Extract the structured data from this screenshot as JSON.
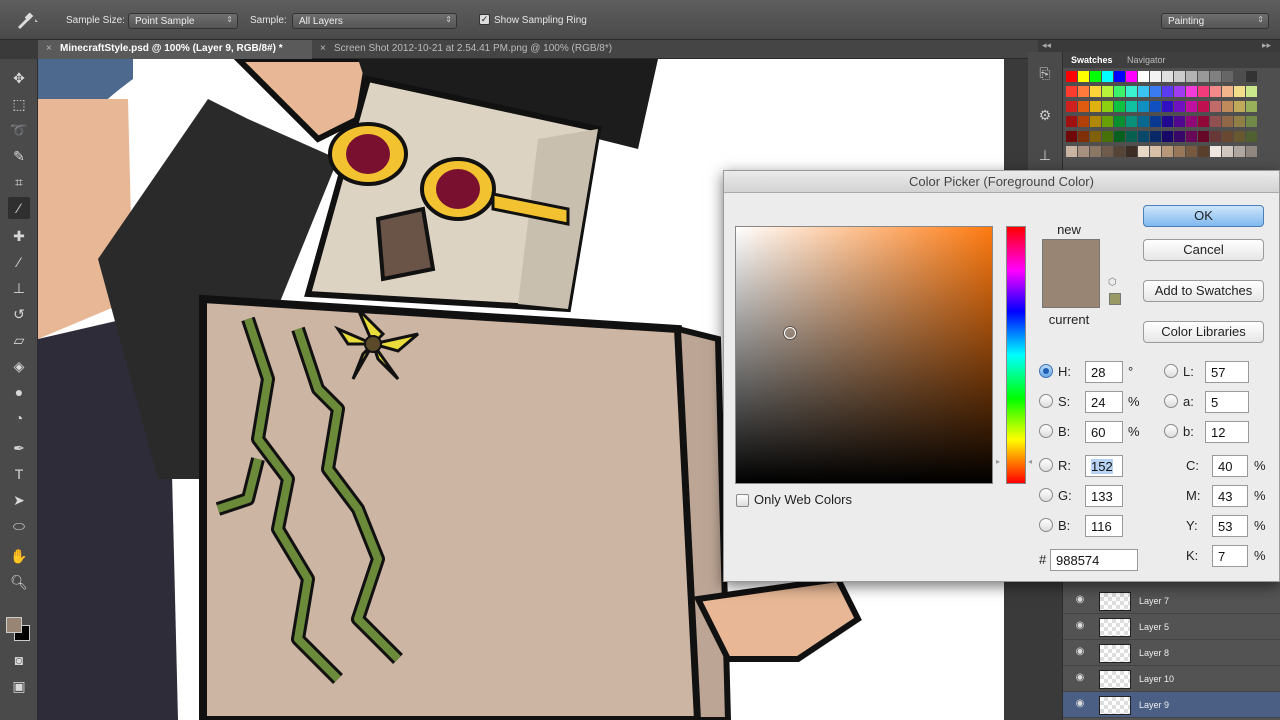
{
  "options_bar": {
    "tool_icon": "eyedropper-icon",
    "sample_size_label": "Sample Size:",
    "sample_size_value": "Point Sample",
    "sample_label": "Sample:",
    "sample_value": "All Layers",
    "show_sampling_ring_label": "Show Sampling Ring",
    "show_sampling_ring_checked": true,
    "workspace_value": "Painting"
  },
  "doc_tabs": [
    {
      "label": "MinecraftStyle.psd @ 100% (Layer 9, RGB/8#) *",
      "active": true
    },
    {
      "label": "Screen Shot 2012-10-21 at 2.54.41 PM.png @ 100% (RGB/8*)",
      "active": false
    }
  ],
  "tools": [
    "move-icon",
    "marquee-icon",
    "lasso-icon",
    "quick-select-icon",
    "crop-icon",
    "eyedropper-icon",
    "healing-icon",
    "brush-icon",
    "clone-stamp-icon",
    "history-brush-icon",
    "eraser-icon",
    "paint-bucket-icon",
    "blur-icon",
    "dodge-icon",
    "pen-icon",
    "type-icon",
    "path-select-icon",
    "shape-icon",
    "hand-icon",
    "zoom-icon"
  ],
  "colors": {
    "foreground": "#988574",
    "background": "#000000",
    "skin": "#e8b896",
    "box": "#cdb5a4",
    "vine": "#6b8a3a",
    "glasses": "#f2c230",
    "head": "#ddd3c2"
  },
  "swatches_panel": {
    "tabs": [
      "Swatches",
      "Navigator"
    ],
    "active_tab": "Swatches",
    "swatch_colors": [
      [
        "#ff0000",
        "#ffff00",
        "#00ff00",
        "#00ffff",
        "#0000ff",
        "#ff00ff",
        "#ffffff",
        "#f2f2f2",
        "#e0e0e0",
        "#cccccc",
        "#b3b3b3",
        "#999999",
        "#808080",
        "#666666",
        "#4d4d4d",
        "#333333"
      ],
      [
        "#ff3b30",
        "#ff7a3b",
        "#ffd43b",
        "#b7f23b",
        "#3bf26a",
        "#3bf2d0",
        "#3bc4f2",
        "#3b7bf2",
        "#5a3bf2",
        "#a03bf2",
        "#f23bd9",
        "#f23b7a",
        "#f28a8a",
        "#f2b48a",
        "#f2dd8a",
        "#cbe88a"
      ],
      [
        "#d02020",
        "#e05a10",
        "#e0b010",
        "#8ccf10",
        "#10c040",
        "#10c0a0",
        "#1090c0",
        "#1050c0",
        "#3010c0",
        "#7010c0",
        "#c010a0",
        "#c01050",
        "#c06a6a",
        "#c08a5a",
        "#c0aa5a",
        "#98b05a"
      ],
      [
        "#a01010",
        "#b04008",
        "#b08808",
        "#68a008",
        "#089030",
        "#089078",
        "#086890",
        "#083890",
        "#200890",
        "#500890",
        "#900878",
        "#900838",
        "#905050",
        "#906848",
        "#908048",
        "#708848"
      ],
      [
        "#700808",
        "#803008",
        "#806008",
        "#487008",
        "#086020",
        "#086050",
        "#084868",
        "#082868",
        "#180868",
        "#380868",
        "#680858",
        "#680828",
        "#683838",
        "#684830",
        "#685830",
        "#506030"
      ],
      [
        "#c8b4a0",
        "#a89080",
        "#8c7664",
        "#705c4c",
        "#564436",
        "#3c2e24",
        "#e8d8c8",
        "#d8c0a8",
        "#b89878",
        "#987858",
        "#785a40",
        "#5a402c",
        "#f0e8e0",
        "#d0c8c0",
        "#b0a8a0",
        "#908880"
      ]
    ]
  },
  "layers": [
    {
      "name": "Layer 7",
      "active": false
    },
    {
      "name": "Layer 5",
      "active": false
    },
    {
      "name": "Layer 8",
      "active": false
    },
    {
      "name": "Layer 10",
      "active": false
    },
    {
      "name": "Layer 9",
      "active": true
    }
  ],
  "color_picker": {
    "title": "Color Picker (Foreground Color)",
    "new_label": "new",
    "current_label": "current",
    "new_color": "#988574",
    "current_color": "#988574",
    "buttons": {
      "ok": "OK",
      "cancel": "Cancel",
      "add_to_swatches": "Add to Swatches",
      "color_libraries": "Color Libraries"
    },
    "only_web_colors_label": "Only Web Colors",
    "only_web_colors_checked": false,
    "hsb": {
      "h": {
        "label": "H:",
        "value": "28",
        "unit": "°",
        "selected": true
      },
      "s": {
        "label": "S:",
        "value": "24",
        "unit": "%",
        "selected": false
      },
      "b": {
        "label": "B:",
        "value": "60",
        "unit": "%",
        "selected": false
      }
    },
    "rgb": {
      "r": {
        "label": "R:",
        "value": "152"
      },
      "g": {
        "label": "G:",
        "value": "133"
      },
      "b": {
        "label": "B:",
        "value": "116"
      }
    },
    "lab": {
      "l": {
        "label": "L:",
        "value": "57"
      },
      "a": {
        "label": "a:",
        "value": "5"
      },
      "b": {
        "label": "b:",
        "value": "12"
      }
    },
    "cmyk": {
      "c": {
        "label": "C:",
        "value": "40",
        "unit": "%"
      },
      "m": {
        "label": "M:",
        "value": "43",
        "unit": "%"
      },
      "y": {
        "label": "Y:",
        "value": "53",
        "unit": "%"
      },
      "k": {
        "label": "K:",
        "value": "7",
        "unit": "%"
      }
    },
    "hex": {
      "label": "#",
      "value": "988574"
    }
  }
}
